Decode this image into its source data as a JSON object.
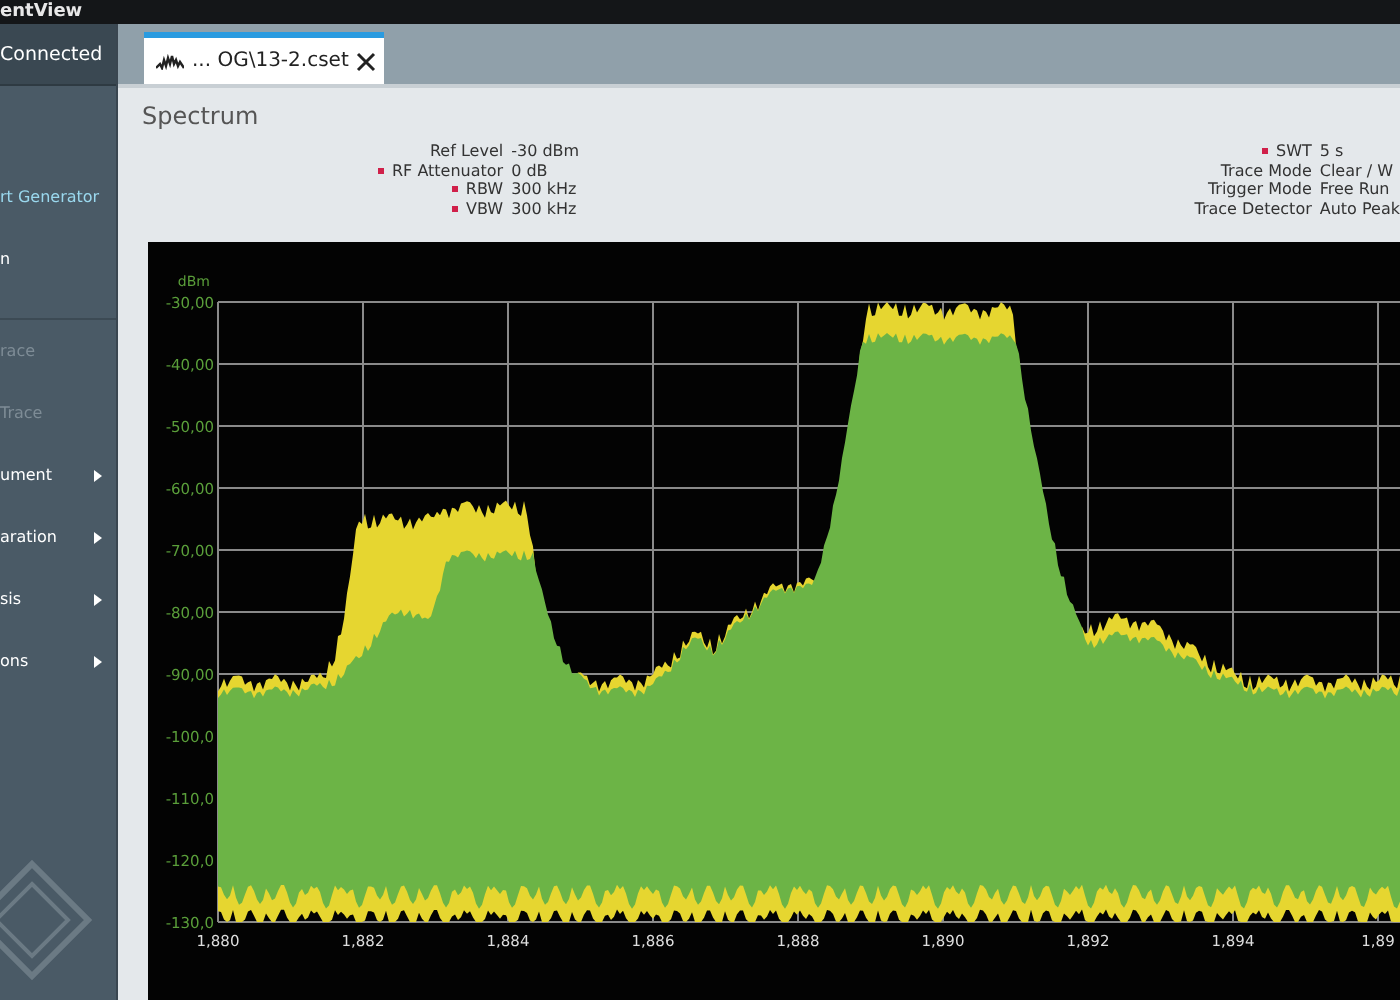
{
  "window": {
    "title": "entView"
  },
  "sidebar": {
    "header": "Connected",
    "items": [
      {
        "label": "rt Generator",
        "selected": true,
        "disabled": false,
        "submenu": false
      },
      {
        "label": "n",
        "selected": false,
        "disabled": false,
        "submenu": false
      },
      {
        "label": "race",
        "selected": false,
        "disabled": true,
        "submenu": false
      },
      {
        "label": "Trace",
        "selected": false,
        "disabled": true,
        "submenu": false
      },
      {
        "label": "ument",
        "selected": false,
        "disabled": false,
        "submenu": true
      },
      {
        "label": "aration",
        "selected": false,
        "disabled": false,
        "submenu": true
      },
      {
        "label": "sis",
        "selected": false,
        "disabled": false,
        "submenu": true
      },
      {
        "label": "ons",
        "selected": false,
        "disabled": false,
        "submenu": true
      }
    ]
  },
  "tabs": [
    {
      "label": "... OG\\13-2.cset",
      "selected": true
    }
  ],
  "panel": {
    "title": "Spectrum",
    "settings_left": [
      {
        "label": "Ref Level",
        "value": "-30 dBm",
        "flagged": false
      },
      {
        "label": "RF Attenuator",
        "value": "0 dB",
        "flagged": true
      },
      {
        "label": "RBW",
        "value": "300 kHz",
        "flagged": true
      },
      {
        "label": "VBW",
        "value": "300 kHz",
        "flagged": true
      }
    ],
    "settings_right": [
      {
        "label": "SWT",
        "value": "5 s",
        "flagged": true
      },
      {
        "label": "Trace Mode",
        "value": "Clear / W",
        "flagged": false
      },
      {
        "label": "Trigger Mode",
        "value": "Free Run",
        "flagged": false
      },
      {
        "label": "Trace Detector",
        "value": "Auto Peak",
        "flagged": false
      }
    ]
  },
  "plot": {
    "y_unit": "dBm",
    "y_ticks": [
      "-30,00",
      "-40,00",
      "-50,00",
      "-60,00",
      "-70,00",
      "-80,00",
      "-90,00",
      "-100,0",
      "-110,0",
      "-120,0",
      "-130,0"
    ],
    "x_ticks": [
      "1,880",
      "1,882",
      "1,884",
      "1,886",
      "1,888",
      "1,890",
      "1,892",
      "1,894",
      "1,89"
    ]
  }
}
